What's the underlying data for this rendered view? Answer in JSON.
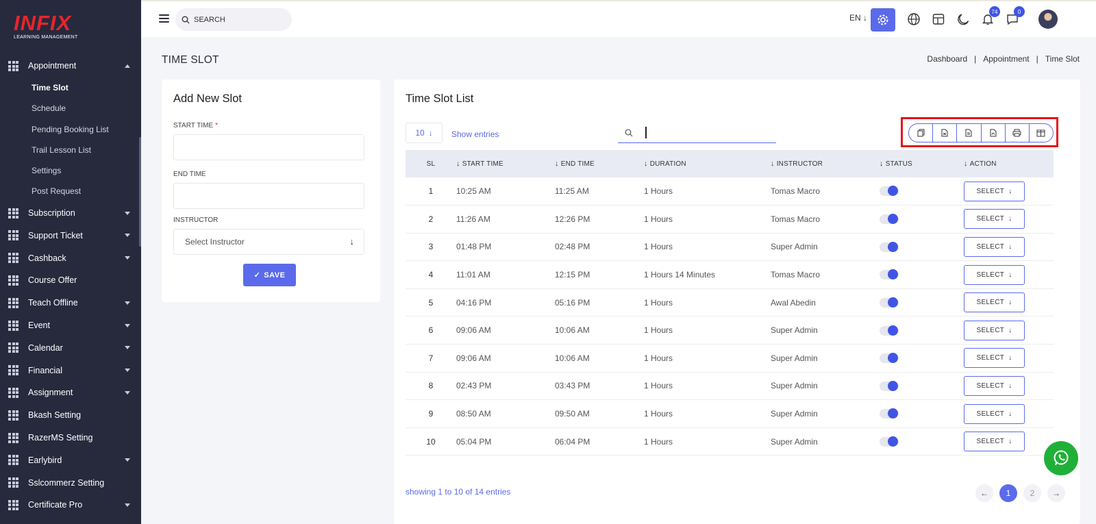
{
  "brand": {
    "name": "INFIX",
    "tagline": "LEARNING MANAGEMENT"
  },
  "sidebar": {
    "items": [
      {
        "label": "Appointment",
        "expanded": true,
        "children": [
          "Time Slot",
          "Schedule",
          "Pending Booking List",
          "Trail Lesson List",
          "Settings",
          "Post Request"
        ],
        "active_child": "Time Slot"
      },
      {
        "label": "Subscription",
        "has_arrow": true
      },
      {
        "label": "Support Ticket",
        "has_arrow": true
      },
      {
        "label": "Cashback",
        "has_arrow": true
      },
      {
        "label": "Course Offer",
        "has_arrow": false
      },
      {
        "label": "Teach Offline",
        "has_arrow": true
      },
      {
        "label": "Event",
        "has_arrow": true
      },
      {
        "label": "Calendar",
        "has_arrow": true
      },
      {
        "label": "Financial",
        "has_arrow": true
      },
      {
        "label": "Assignment",
        "has_arrow": true
      },
      {
        "label": "Bkash Setting",
        "has_arrow": false
      },
      {
        "label": "RazerMS Setting",
        "has_arrow": false
      },
      {
        "label": "Earlybird",
        "has_arrow": true
      },
      {
        "label": "Sslcommerz Setting",
        "has_arrow": false
      },
      {
        "label": "Certificate Pro",
        "has_arrow": true
      }
    ]
  },
  "topbar": {
    "search_placeholder": "SEARCH",
    "language": "EN",
    "notifications_count": "74",
    "messages_count": "0"
  },
  "page": {
    "title": "TIME SLOT",
    "breadcrumb": [
      "Dashboard",
      "Appointment",
      "Time Slot"
    ]
  },
  "form": {
    "title": "Add New Slot",
    "start_time_label": "START TIME",
    "required_mark": "*",
    "end_time_label": "END TIME",
    "instructor_label": "INSTRUCTOR",
    "instructor_placeholder": "Select Instructor",
    "save_label": "SAVE"
  },
  "list": {
    "title": "Time Slot List",
    "page_size": "10",
    "show_entries": "Show entries",
    "search_value": "",
    "export_buttons": [
      "copy",
      "excel",
      "csv",
      "pdf",
      "print",
      "columns"
    ],
    "columns": [
      "SL",
      "START TIME",
      "END TIME",
      "DURATION",
      "INSTRUCTOR",
      "STATUS",
      "ACTION"
    ],
    "rows": [
      {
        "sl": "1",
        "start": "10:25 AM",
        "end": "11:25 AM",
        "duration": "1 Hours",
        "instructor": "Tomas Macro",
        "status": true,
        "action": "SELECT"
      },
      {
        "sl": "2",
        "start": "11:26 AM",
        "end": "12:26 PM",
        "duration": "1 Hours",
        "instructor": "Tomas Macro",
        "status": true,
        "action": "SELECT"
      },
      {
        "sl": "3",
        "start": "01:48 PM",
        "end": "02:48 PM",
        "duration": "1 Hours",
        "instructor": "Super Admin",
        "status": true,
        "action": "SELECT"
      },
      {
        "sl": "4",
        "start": "11:01 AM",
        "end": "12:15 PM",
        "duration": "1 Hours 14 Minutes",
        "instructor": "Tomas Macro",
        "status": true,
        "action": "SELECT"
      },
      {
        "sl": "5",
        "start": "04:16 PM",
        "end": "05:16 PM",
        "duration": "1 Hours",
        "instructor": "Awal Abedin",
        "status": true,
        "action": "SELECT"
      },
      {
        "sl": "6",
        "start": "09:06 AM",
        "end": "10:06 AM",
        "duration": "1 Hours",
        "instructor": "Super Admin",
        "status": true,
        "action": "SELECT"
      },
      {
        "sl": "7",
        "start": "09:06 AM",
        "end": "10:06 AM",
        "duration": "1 Hours",
        "instructor": "Super Admin",
        "status": true,
        "action": "SELECT"
      },
      {
        "sl": "8",
        "start": "02:43 PM",
        "end": "03:43 PM",
        "duration": "1 Hours",
        "instructor": "Super Admin",
        "status": true,
        "action": "SELECT"
      },
      {
        "sl": "9",
        "start": "08:50 AM",
        "end": "09:50 AM",
        "duration": "1 Hours",
        "instructor": "Super Admin",
        "status": true,
        "action": "SELECT"
      },
      {
        "sl": "10",
        "start": "05:04 PM",
        "end": "06:04 PM",
        "duration": "1 Hours",
        "instructor": "Super Admin",
        "status": true,
        "action": "SELECT"
      }
    ],
    "footer": "showing 1 to 10 of 14 entries",
    "pages": [
      "1",
      "2"
    ],
    "current_page": "1"
  },
  "colors": {
    "sidebar_bg": "#27293d",
    "accent": "#5b6aea",
    "highlight_box": "#e5141c",
    "whatsapp": "#20b038"
  }
}
